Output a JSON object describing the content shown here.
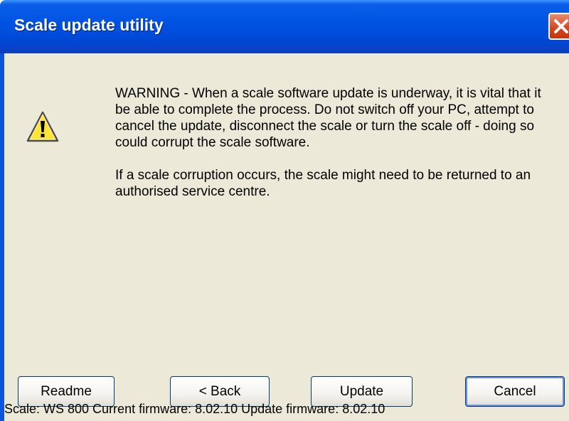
{
  "window": {
    "title": "Scale update utility"
  },
  "message": {
    "paragraph1": "WARNING - When a scale software update is underway, it is vital that it be able to complete the process. Do not switch off your PC, attempt to cancel the update, disconnect the scale or turn the scale off - doing so could corrupt the scale software.",
    "paragraph2": "If a scale corruption occurs, the scale might need to be returned to an authorised service centre."
  },
  "buttons": {
    "readme": "Readme",
    "back": "< Back",
    "update": "Update",
    "cancel": "Cancel"
  },
  "status": {
    "text": "Scale: WS 800 Current firmware: 8.02.10 Update firmware: 8.02.10"
  },
  "icons": {
    "warning": "warning-triangle-icon",
    "close": "close-icon"
  },
  "colors": {
    "titlebar": "#0054e3",
    "client": "#ece9d8",
    "close_button": "#d6421f"
  }
}
